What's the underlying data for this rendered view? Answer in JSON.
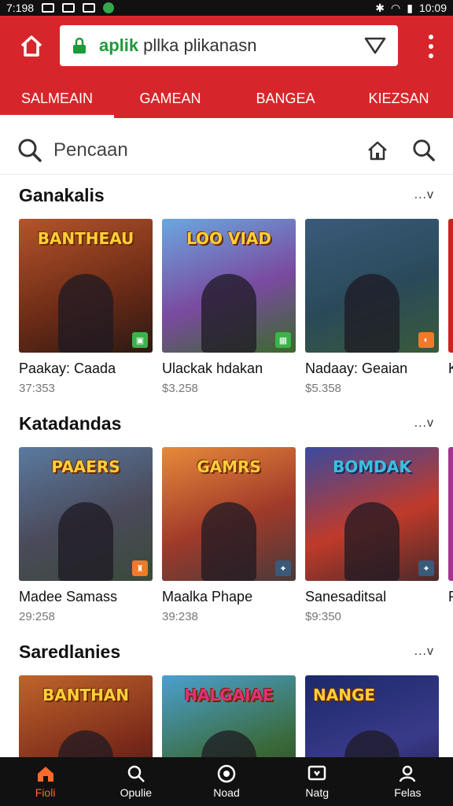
{
  "status_bar": {
    "time": "7:198",
    "right_time": "10:09"
  },
  "browser": {
    "url_domain": "aplik",
    "url_text": "pllka plikanasn",
    "icons": [
      "home-icon",
      "lock-icon",
      "dropdown-icon",
      "more-vert-icon"
    ]
  },
  "tabs": [
    {
      "label": "SALMEAIN",
      "active": true
    },
    {
      "label": "GAMEAN",
      "active": false
    },
    {
      "label": "BANGEA",
      "active": false
    },
    {
      "label": "KIEZSAN",
      "active": false
    }
  ],
  "search": {
    "placeholder": "Pencaan"
  },
  "sections": [
    {
      "title": "Ganakalis",
      "more": "...v",
      "cards": [
        {
          "title": "Paakay: Caada",
          "sub": "37:353",
          "logo": "BANTHEAU"
        },
        {
          "title": "Ulackak hdakan",
          "sub": "$3.258",
          "logo": "LOO VIAD"
        },
        {
          "title": "Nadaay: Geaian",
          "sub": "$5.358",
          "logo": ""
        },
        {
          "title": "K",
          "sub": "",
          "logo": ""
        }
      ]
    },
    {
      "title": "Katadandas",
      "more": "...v",
      "cards": [
        {
          "title": "Madee Samass",
          "sub": "29:258",
          "logo": "PAAERS"
        },
        {
          "title": "Maalka Phape",
          "sub": "39:238",
          "logo": "GAMRS"
        },
        {
          "title": "Sanesaditsal",
          "sub": "$9:350",
          "logo": "BOMDAK"
        },
        {
          "title": "P",
          "sub": "",
          "logo": ""
        }
      ]
    },
    {
      "title": "Saredlanies",
      "more": "...v",
      "cards": [
        {
          "title": "",
          "sub": "",
          "logo": "BANTHAN"
        },
        {
          "title": "",
          "sub": "",
          "logo": "HALGAIAE"
        },
        {
          "title": "",
          "sub": "",
          "logo": "NANGE"
        }
      ]
    }
  ],
  "bottom_nav": [
    {
      "label": "Fioli",
      "icon": "home-icon",
      "active": true
    },
    {
      "label": "Opulie",
      "icon": "search-icon",
      "active": false
    },
    {
      "label": "Noad",
      "icon": "circle-icon",
      "active": false
    },
    {
      "label": "Natg",
      "icon": "store-icon",
      "active": false
    },
    {
      "label": "Felas",
      "icon": "person-icon",
      "active": false
    }
  ],
  "colors": {
    "brand_red": "#d7262b",
    "nav_active": "#ff6a2a",
    "url_green": "#1f9a3a"
  }
}
